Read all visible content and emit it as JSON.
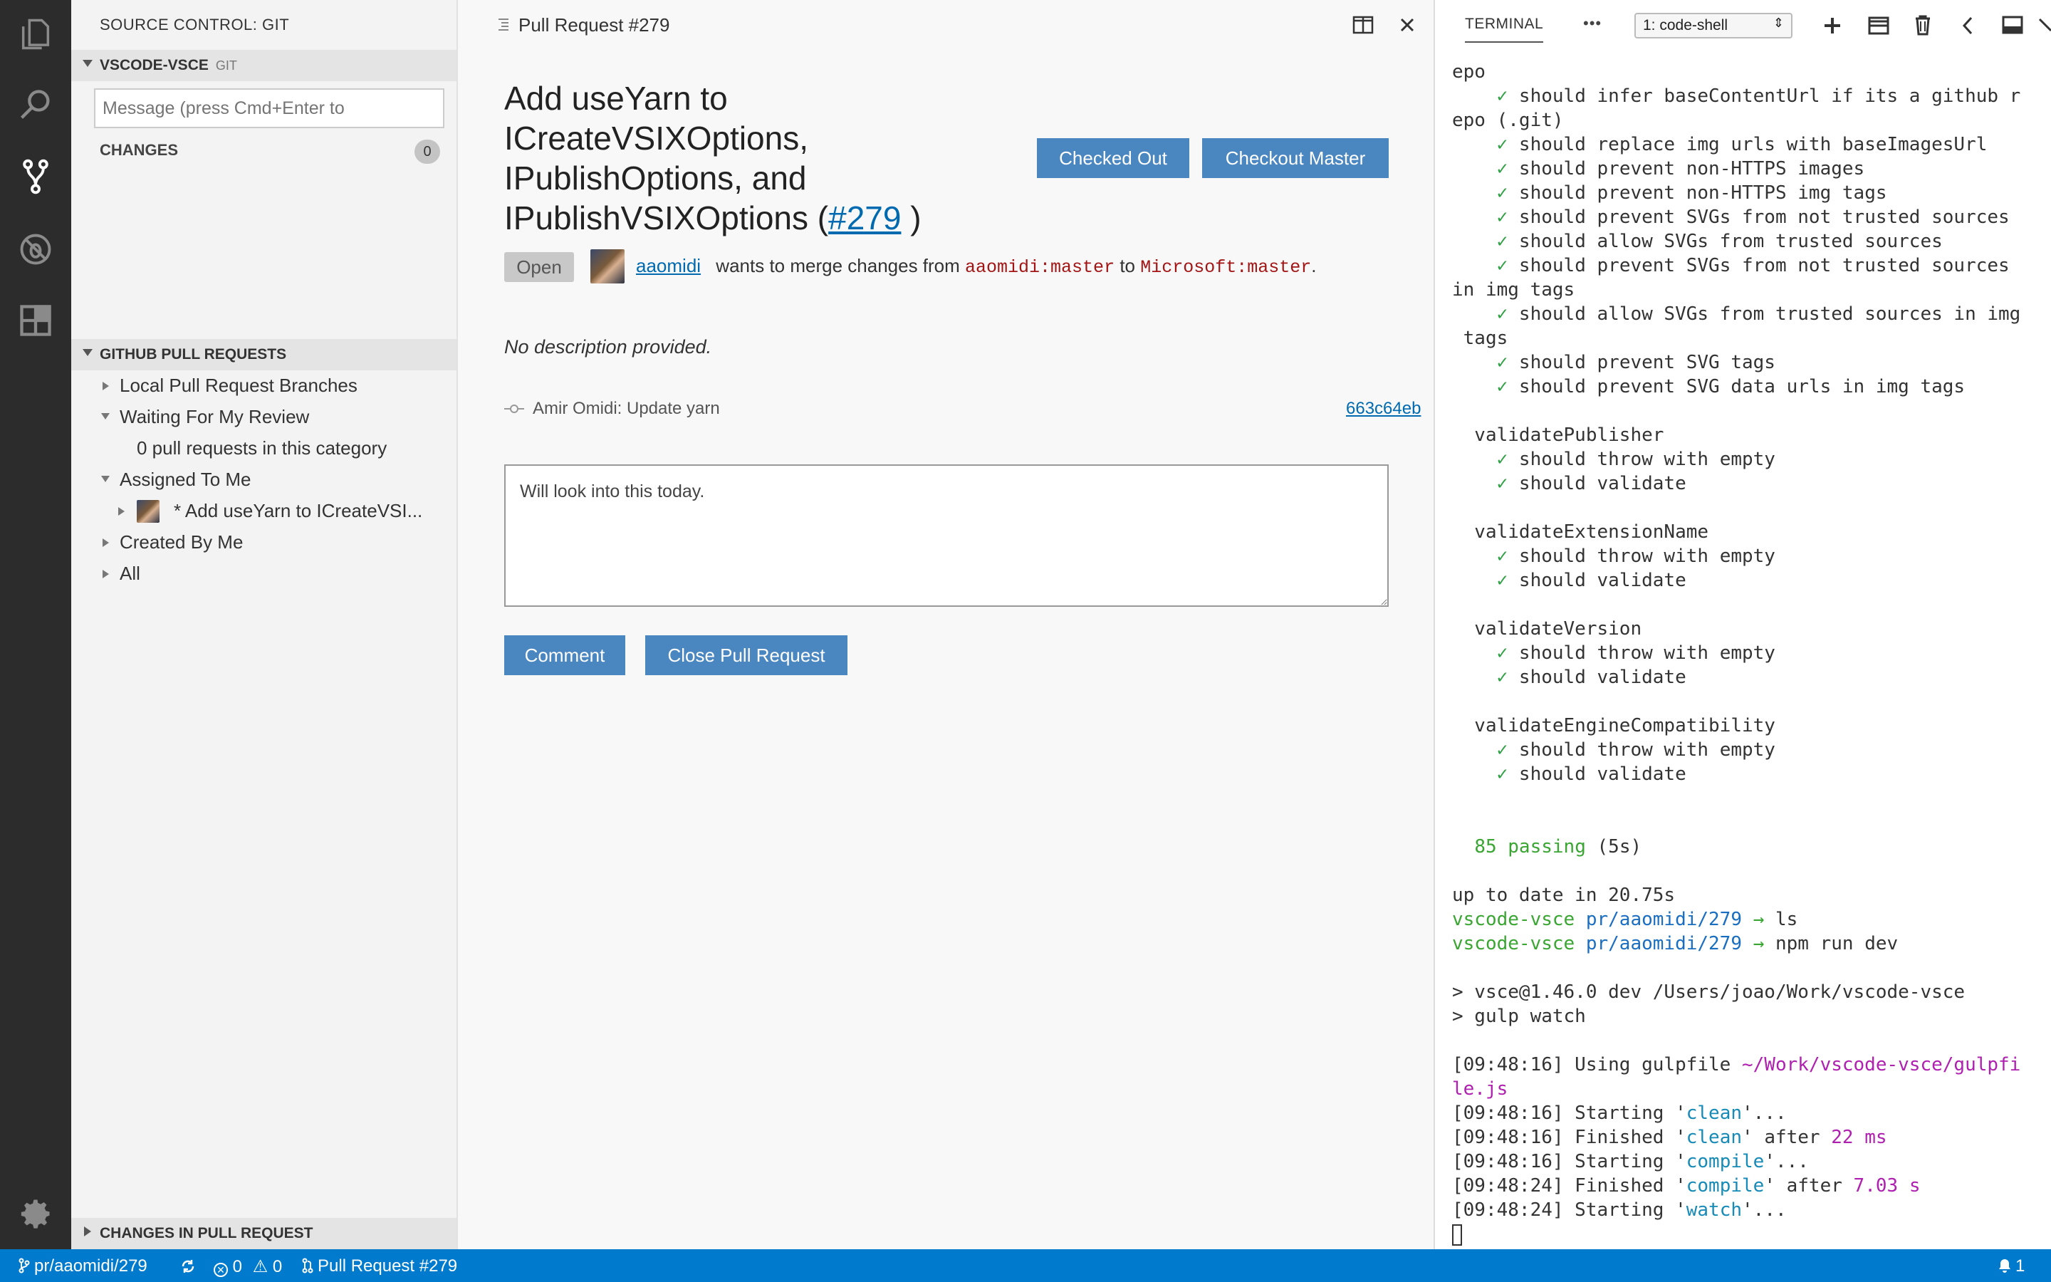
{
  "sidebar": {
    "title": "SOURCE CONTROL: GIT",
    "repo": {
      "name": "VSCODE-VSCE",
      "provider": "GIT"
    },
    "commit_placeholder": "Message (press Cmd+Enter to",
    "changes_label": "CHANGES",
    "changes_count": "0",
    "pr_section_title": "GITHUB PULL REQUESTS",
    "tree": [
      {
        "label": "Local Pull Request Branches"
      },
      {
        "label": "Waiting For My Review"
      },
      {
        "label": "0 pull requests in this category"
      },
      {
        "label": "Assigned To Me"
      },
      {
        "label": "* Add useYarn to ICreateVSI..."
      },
      {
        "label": "Created By Me"
      },
      {
        "label": "All"
      }
    ],
    "changes_in_pr_title": "CHANGES IN PULL REQUEST"
  },
  "editor": {
    "tab_title": "Pull Request #279",
    "pr": {
      "title_text": "Add useYarn to ICreateVSIXOptions, IPublishOptions, and IPublishVSIXOptions (",
      "number_link": "#279",
      "title_close": " )",
      "state": "Open",
      "author": "aaomidi",
      "merge_text": "wants to merge changes from",
      "from_branch": "aaomidi:master",
      "to_word": "to",
      "to_branch": "Microsoft:master",
      "period": ".",
      "description": "No description provided.",
      "commit_message": "Amir Omidi: Update yarn",
      "commit_sha": "663c64eb",
      "comment_text": "Will look into this today."
    },
    "buttons": {
      "checked_out": "Checked Out",
      "checkout_master": "Checkout Master",
      "comment": "Comment",
      "close_pr": "Close Pull Request"
    }
  },
  "terminal": {
    "tab_label": "TERMINAL",
    "shell_select": "1: code-shell",
    "more": "•••"
  },
  "statusbar": {
    "branch": "pr/aaomidi/279",
    "errors": "0",
    "warnings": "0",
    "pr_label": "Pull Request #279",
    "notifications": "1"
  },
  "colors": {
    "activity_bar": "#2c2c2c",
    "status_bar": "#007acc",
    "button": "#4a86c0",
    "link": "#006ab1"
  }
}
